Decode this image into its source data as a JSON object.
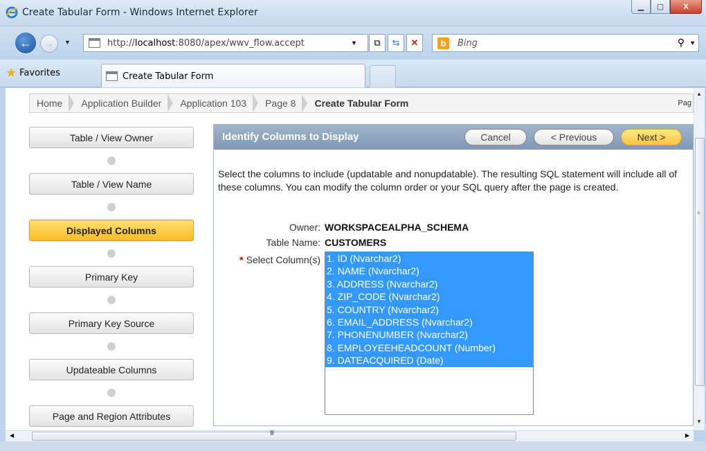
{
  "window": {
    "title": "Create Tabular Form - Windows Internet Explorer",
    "buttons": {
      "minimize": "▁",
      "maximize": "▢",
      "close": "X"
    }
  },
  "navbar": {
    "url_prefix": "http://",
    "url_host": "localhost",
    "url_rest": ":8080/apex/wwv_flow.accept",
    "search_placeholder": "Bing"
  },
  "favorites": {
    "label": "Favorites",
    "tab_title": "Create Tabular Form"
  },
  "breadcrumb": {
    "items": [
      "Home",
      "Application Builder",
      "Application 103",
      "Page 8"
    ],
    "current": "Create Tabular Form",
    "right_text": "Pag"
  },
  "wizard": {
    "steps": [
      {
        "label": "Table / View Owner",
        "active": false
      },
      {
        "label": "Table / View Name",
        "active": false
      },
      {
        "label": "Displayed Columns",
        "active": true
      },
      {
        "label": "Primary Key",
        "active": false
      },
      {
        "label": "Primary Key Source",
        "active": false
      },
      {
        "label": "Updateable Columns",
        "active": false
      },
      {
        "label": "Page and Region Attributes",
        "active": false
      }
    ]
  },
  "region": {
    "title": "Identify Columns to Display",
    "cancel_label": "Cancel",
    "previous_label": "< Previous",
    "next_label": "Next >",
    "instructions": "Select the columns to include (updatable and nonupdatable). The resulting SQL statement will include all of these columns. You can modify the column order or your SQL query after the page is created.",
    "owner_label": "Owner:",
    "owner_value": "WORKSPACEALPHA_SCHEMA",
    "table_label": "Table Name:",
    "table_value": "CUSTOMERS",
    "columns_required_marker": "*",
    "columns_label": "Select Column(s)",
    "columns": [
      "1. ID (Nvarchar2)",
      "2. NAME (Nvarchar2)",
      "3. ADDRESS (Nvarchar2)",
      "4. ZIP_CODE (Nvarchar2)",
      "5. COUNTRY (Nvarchar2)",
      "6. EMAIL_ADDRESS (Nvarchar2)",
      "7. PHONENUMBER (Nvarchar2)",
      "8. EMPLOYEEHEADCOUNT (Number)",
      "9. DATEACQUIRED (Date)"
    ]
  },
  "colors": {
    "selection": "#3399ff",
    "active_step": "#fbbd26",
    "region_header": "#8ea5be"
  }
}
